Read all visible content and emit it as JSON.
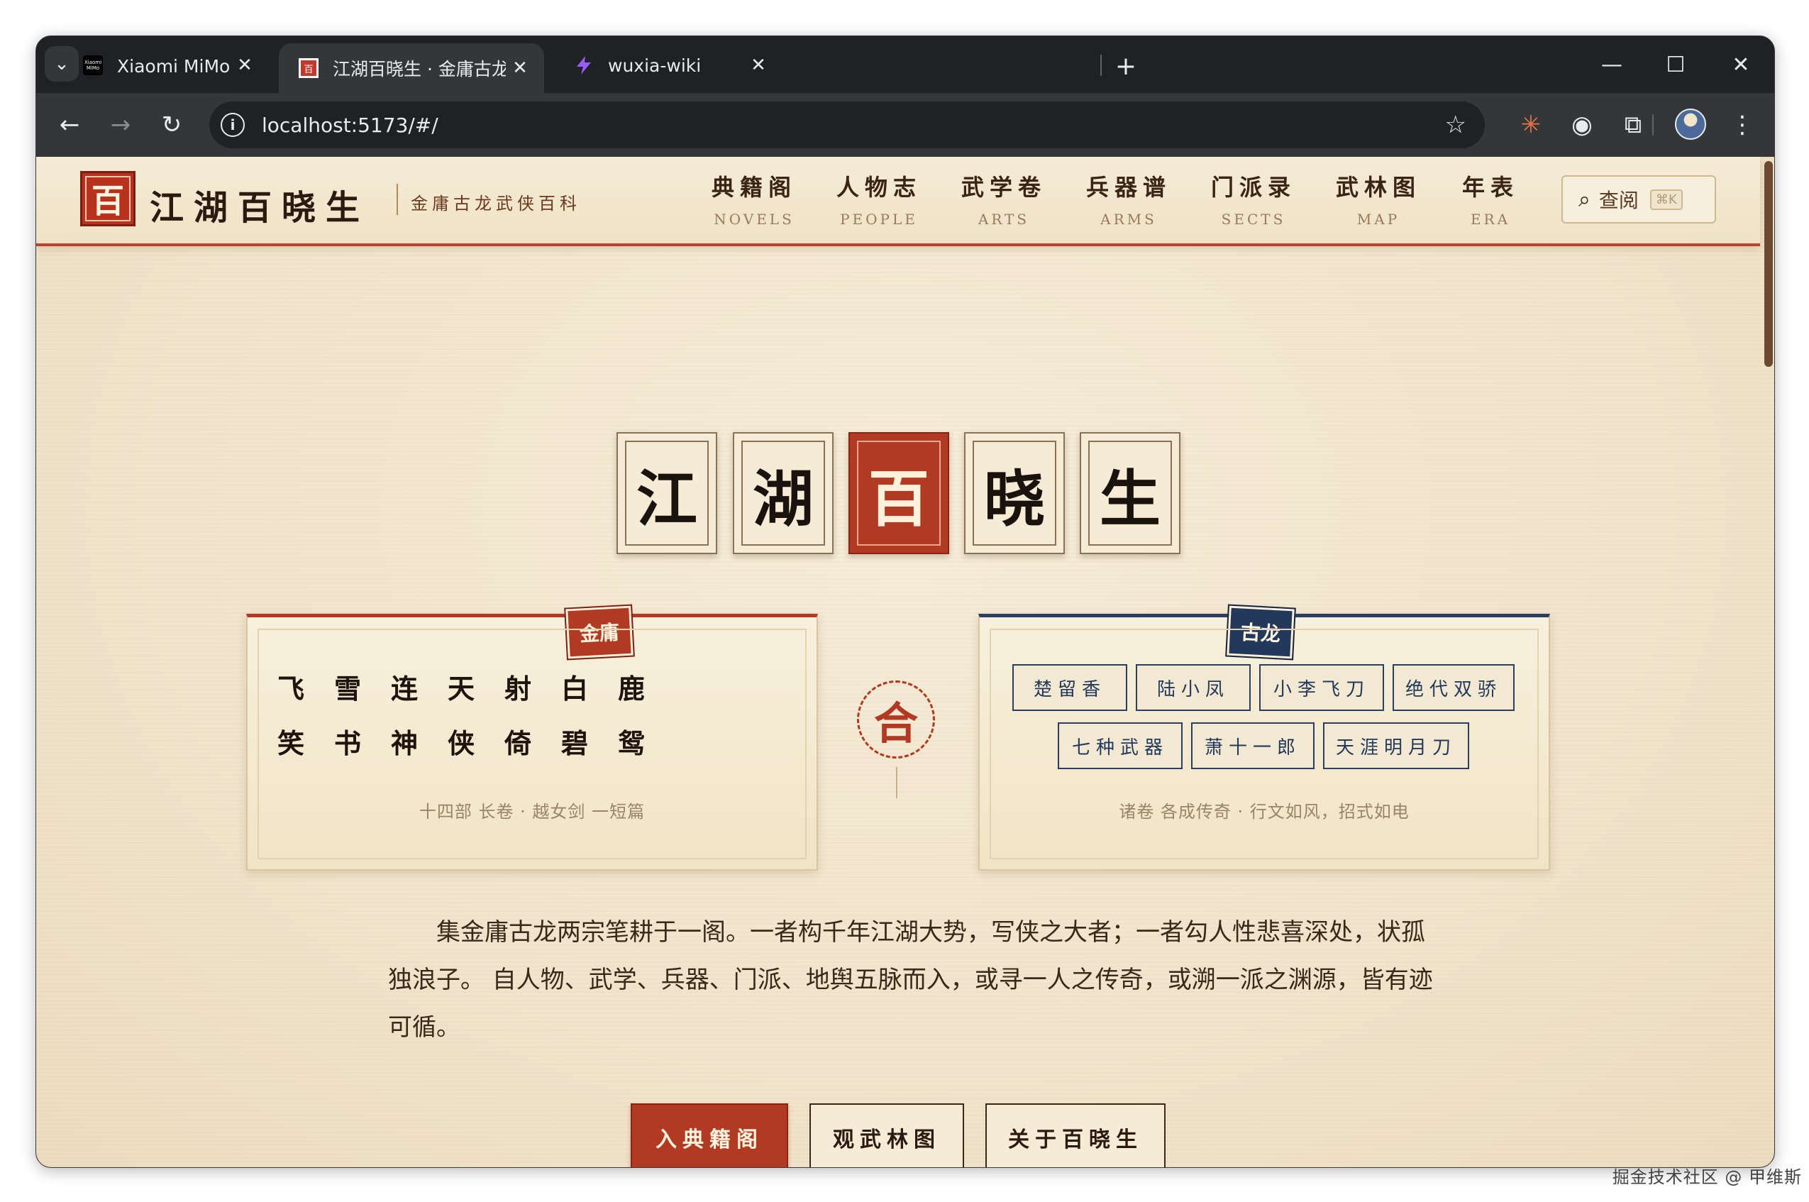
{
  "browser": {
    "tabs": [
      {
        "title": "Xiaomi MiMo 开放平台",
        "favicon": "mimo-logo-icon",
        "favicon_text": "Xiaomi MiMo"
      },
      {
        "title": "江湖百晓生 · 金庸古龙武侠百科",
        "favicon": "bai-seal-icon",
        "favicon_text": "百"
      },
      {
        "title": "wuxia-wiki",
        "favicon": "vite-bolt-icon"
      }
    ],
    "url": "localhost:5173/#/",
    "icons": {
      "tab_search": "⌄",
      "close": "✕",
      "new_tab": "+",
      "minimize": "—",
      "maximize": "☐",
      "window_close": "✕",
      "back": "←",
      "forward": "→",
      "reload": "↻",
      "info": "i",
      "bookmark": "☆",
      "ext1": "✳",
      "ext2": "◉",
      "extensions": "⧉",
      "menu": "⋮"
    }
  },
  "site": {
    "logo_seal": "百",
    "logo_title": "江湖百晓生",
    "logo_subtitle": "金庸古龙武侠百科",
    "nav": [
      {
        "zh": "典籍阁",
        "en": "NOVELS"
      },
      {
        "zh": "人物志",
        "en": "PEOPLE"
      },
      {
        "zh": "武学卷",
        "en": "ARTS"
      },
      {
        "zh": "兵器谱",
        "en": "ARMS"
      },
      {
        "zh": "门派录",
        "en": "SECTS"
      },
      {
        "zh": "武林图",
        "en": "MAP"
      },
      {
        "zh": "年表",
        "en": "ERA"
      }
    ],
    "search": {
      "icon": "⌕",
      "label": "查阅",
      "shortcut": "⌘K"
    }
  },
  "hero": {
    "title_chars": [
      "江",
      "湖",
      "百",
      "晓",
      "生"
    ]
  },
  "jinyong": {
    "badge": "金庸",
    "rows": [
      [
        "飞",
        "雪",
        "连",
        "天",
        "射",
        "白",
        "鹿"
      ],
      [
        "笑",
        "书",
        "神",
        "侠",
        "倚",
        "碧",
        "鸳"
      ]
    ],
    "footer": "十四部 长卷 · 越女剑 一短篇"
  },
  "he_seal": "合",
  "gulong": {
    "badge": "古龙",
    "row1": [
      "楚留香",
      "陆小凤",
      "小李飞刀",
      "绝代双骄"
    ],
    "row2": [
      "七种武器",
      "萧十一郎",
      "天涯明月刀"
    ],
    "footer": "诸卷 各成传奇 · 行文如风，招式如电"
  },
  "intro": "集金庸古龙两宗笔耕于一阁。一者构千年江湖大势，写侠之大者；一者勾人性悲喜深处，状孤独浪子。 自人物、武学、兵器、门派、地舆五脉而入，或寻一人之传奇，或溯一派之渊源，皆有迹可循。",
  "buttons": {
    "primary": "入典籍阁",
    "map": "观武林图",
    "about": "关于百晓生"
  },
  "watermark": "掘金技术社区 @ 甲维斯"
}
